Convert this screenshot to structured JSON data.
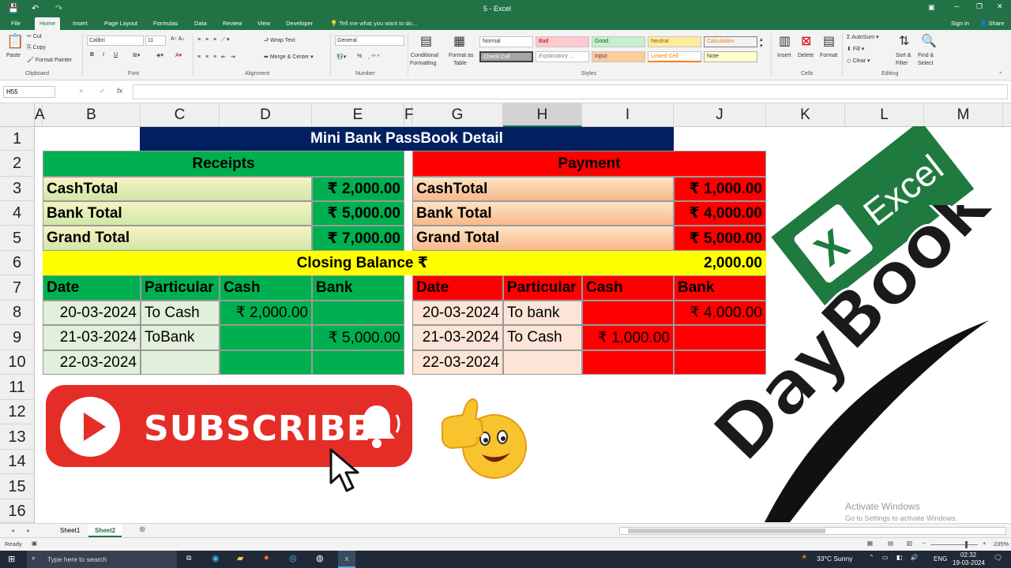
{
  "titlebar": {
    "title": "5 - Excel",
    "sign_in": "Sign in",
    "share": "Share"
  },
  "tabs": [
    "File",
    "Home",
    "Insert",
    "Page Layout",
    "Formulas",
    "Data",
    "Review",
    "View",
    "Developer"
  ],
  "tell_me": "Tell me what you want to do...",
  "ribbon": {
    "paste": "Paste",
    "cut": "Cut",
    "copy": "Copy",
    "format_painter": "Format Painter",
    "clipboard": "Clipboard",
    "font_name": "Calibri",
    "font_size": "11",
    "font": "Font",
    "bold": "B",
    "italic": "I",
    "underline": "U",
    "wrap_text": "Wrap Text",
    "merge_center": "Merge & Center",
    "alignment": "Alignment",
    "number_format": "General",
    "number": "Number",
    "percent": "%",
    "conditional": "Conditional",
    "formatting": "Formatting",
    "format_as": "Format as",
    "table": "Table",
    "styles": "Styles",
    "style_normal": "Normal",
    "style_bad": "Bad",
    "style_good": "Good",
    "style_neutral": "Neutral",
    "style_calc": "Calculation",
    "style_check": "Check Cell",
    "style_explanatory": "Explanatory ...",
    "style_input": "Input",
    "style_linked": "Linked Cell",
    "style_note": "Note",
    "insert": "Insert",
    "delete": "Delete",
    "format": "Format",
    "cells": "Cells",
    "autosum": "AutoSum",
    "fill": "Fill",
    "clear": "Clear",
    "sort_filter": "Sort &",
    "filter": "Filter",
    "find_select": "Find &",
    "select": "Select",
    "editing": "Editing"
  },
  "formula_bar": {
    "name_box": "H55",
    "fx": "fx",
    "cancel": "×",
    "enter": "✓",
    "content": ""
  },
  "columns": [
    "A",
    "B",
    "C",
    "D",
    "E",
    "F",
    "G",
    "H",
    "I",
    "J",
    "K",
    "L",
    "M"
  ],
  "rows": [
    "1",
    "2",
    "3",
    "4",
    "5",
    "6",
    "7",
    "8",
    "9",
    "10",
    "11",
    "12",
    "13",
    "14",
    "15",
    "16"
  ],
  "sheet": {
    "title": "Mini Bank PassBook Detail",
    "receipts": {
      "header": "Receipts",
      "cash_total_label": "CashTotal",
      "cash_total": "₹ 2,000.00",
      "bank_total_label": "Bank Total",
      "bank_total": "₹ 5,000.00",
      "grand_total_label": "Grand Total",
      "grand_total": "₹ 7,000.00",
      "col_date": "Date",
      "col_particular": "Particular",
      "col_cash": "Cash",
      "col_bank": "Bank",
      "rows": [
        {
          "date": "20-03-2024",
          "particular": "To Cash",
          "cash": "₹ 2,000.00",
          "bank": ""
        },
        {
          "date": "21-03-2024",
          "particular": "ToBank",
          "cash": "",
          "bank": "₹ 5,000.00"
        },
        {
          "date": "22-03-2024",
          "particular": "",
          "cash": "",
          "bank": ""
        }
      ]
    },
    "payment": {
      "header": "Payment",
      "cash_total_label": "CashTotal",
      "cash_total": "₹ 1,000.00",
      "bank_total_label": "Bank Total",
      "bank_total": "₹ 4,000.00",
      "grand_total_label": "Grand Total",
      "grand_total": "₹ 5,000.00",
      "col_date": "Date",
      "col_particular": "Particular",
      "col_cash": "Cash",
      "col_bank": "Bank",
      "rows": [
        {
          "date": "20-03-2024",
          "particular": "To bank",
          "cash": "",
          "bank": "₹ 4,000.00"
        },
        {
          "date": "21-03-2024",
          "particular": "To Cash",
          "cash": "₹ 1,000.00",
          "bank": ""
        },
        {
          "date": "22-03-2024",
          "particular": "",
          "cash": "",
          "bank": ""
        }
      ]
    },
    "closing_label": "Closing Balance  ₹",
    "closing_value": "2,000.00"
  },
  "overlay": {
    "subscribe": "SUBSCRIBE",
    "excel_logo_text": "Excel",
    "daybook": "DayBook"
  },
  "watermark": {
    "line1": "Activate Windows",
    "line2": "Go to Settings to activate Windows."
  },
  "sheet_tabs": [
    "Sheet1",
    "Sheet2"
  ],
  "active_sheet": "Sheet2",
  "status": {
    "ready": "Ready",
    "zoom": "235%"
  },
  "taskbar": {
    "search": "Type here to search",
    "weather": "33°C  Sunny",
    "lang": "ENG",
    "time": "02:32",
    "date": "19-03-2024"
  },
  "colors": {
    "excel_green": "#217346",
    "navy": "#002060",
    "green": "#00b050",
    "red": "#ff0000",
    "yellow": "#ffff00"
  }
}
